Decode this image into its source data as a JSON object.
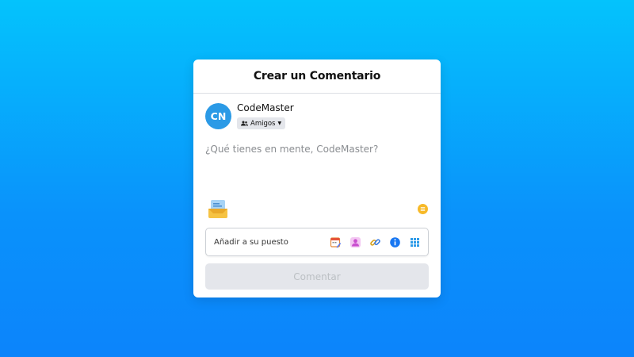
{
  "modal": {
    "title": "Crear un Comentario"
  },
  "user": {
    "initials": "CN",
    "name": "CodeMaster",
    "audience_label": "Amigos",
    "avatar_color": "#2b9ae6"
  },
  "composer": {
    "placeholder": "¿Qué tienes en mente, CodeMaster?",
    "value": ""
  },
  "add_to_post": {
    "label": "Añadir a su puesto",
    "icons": [
      "calendar-edit-icon",
      "person-tag-icon",
      "link-icon",
      "info-icon",
      "grid-icon"
    ]
  },
  "submit": {
    "label": "Comentar"
  },
  "colors": {
    "background_top": "#04c3fc",
    "background_bottom": "#0c84fb",
    "disabled_button_bg": "#e4e6eb",
    "disabled_button_text": "#bcc0c4",
    "emoji_yellow": "#f7b928",
    "info_blue": "#1877f2"
  }
}
